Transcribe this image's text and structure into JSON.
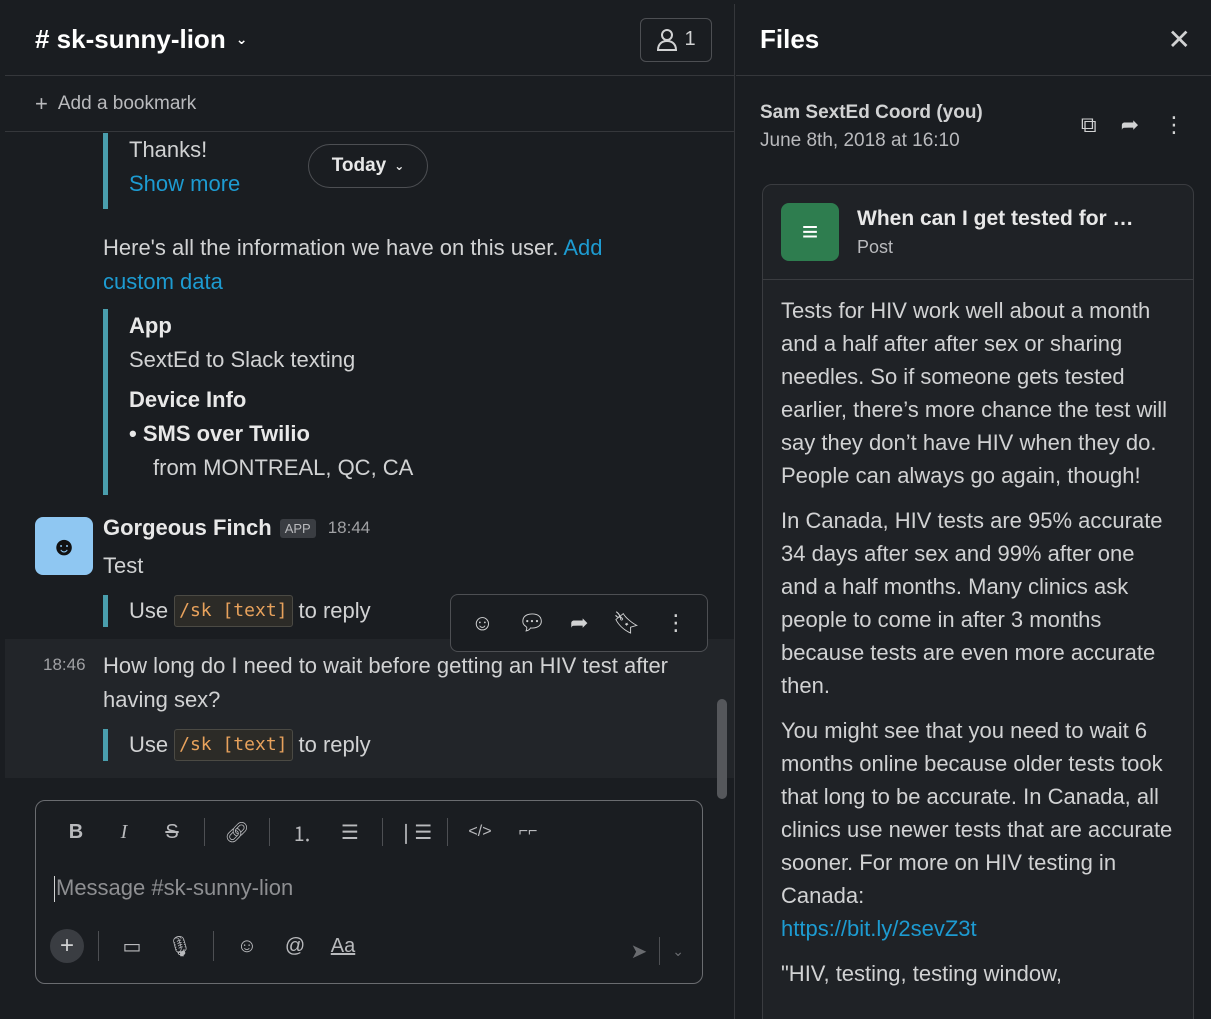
{
  "channel": {
    "name": "# sk-sunny-lion",
    "member_count": "1",
    "add_bookmark": "Add a bookmark"
  },
  "messages": {
    "partial_thanks": "Thanks!",
    "show_more": "Show more",
    "today_label": "Today",
    "info_text": "Here's all the information we have on this user.",
    "info_link": "Add custom data",
    "app_label": "App",
    "app_value": "SextEd to Slack texting",
    "device_label": "Device Info",
    "device_value": "• SMS over Twilio",
    "device_location": "from MONTREAL, QC, CA",
    "bot_name": "Gorgeous Finch",
    "bot_badge": "APP",
    "bot_time": "18:44",
    "bot_text": "Test",
    "reply_prefix": "Use",
    "reply_code": "/sk [text]",
    "reply_suffix": "to reply",
    "question_time": "18:46",
    "question_text": "How long do I need to wait before getting an HIV test after having sex?"
  },
  "composer": {
    "placeholder": "Message #sk-sunny-lion"
  },
  "files_panel": {
    "title": "Files",
    "owner": "Sam SextEd Coord (you)",
    "date": "June 8th, 2018 at 16:10",
    "post_title": "When can I get tested for …",
    "post_type": "Post",
    "paragraphs": [
      "Tests for HIV work well about a month and a half after after sex or sharing needles. So if someone gets tested earlier, there’s more chance the test will say they don’t have HIV when they do. People can always go again, though!",
      "In Canada, HIV tests are 95% accurate 34 days after sex and 99% after one and a half months. Many clinics ask people to come in after 3 months because tests are even more accurate then.",
      "You might see that you need to wait 6 months online because older tests took that long to be accurate. In Canada, all clinics use newer tests that are accurate sooner. For more on HIV testing in Canada:"
    ],
    "link": "https://bit.ly/2sevZ3t",
    "trailing": "\"HIV, testing, testing window,"
  }
}
